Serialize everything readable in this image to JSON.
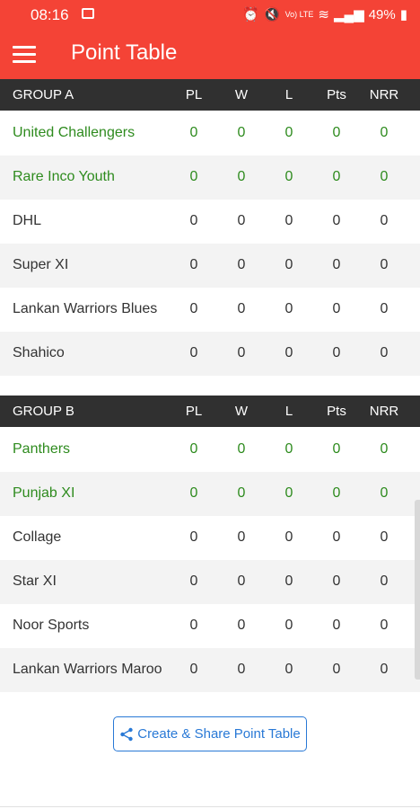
{
  "status": {
    "time": "08:16",
    "battery": "49%",
    "network": "Vo) LTE"
  },
  "app": {
    "title": "Point Table"
  },
  "columns": [
    "PL",
    "W",
    "L",
    "Pts",
    "NRR"
  ],
  "groups": [
    {
      "name": "GROUP A",
      "rows": [
        {
          "team": "United Challengers",
          "pl": "0",
          "w": "0",
          "l": "0",
          "pts": "0",
          "nrr": "0"
        },
        {
          "team": "Rare Inco Youth",
          "pl": "0",
          "w": "0",
          "l": "0",
          "pts": "0",
          "nrr": "0"
        },
        {
          "team": "DHL",
          "pl": "0",
          "w": "0",
          "l": "0",
          "pts": "0",
          "nrr": "0"
        },
        {
          "team": "Super XI",
          "pl": "0",
          "w": "0",
          "l": "0",
          "pts": "0",
          "nrr": "0"
        },
        {
          "team": "Lankan Warriors Blues",
          "pl": "0",
          "w": "0",
          "l": "0",
          "pts": "0",
          "nrr": "0"
        },
        {
          "team": "Shahico",
          "pl": "0",
          "w": "0",
          "l": "0",
          "pts": "0",
          "nrr": "0"
        }
      ]
    },
    {
      "name": "GROUP B",
      "rows": [
        {
          "team": "Panthers",
          "pl": "0",
          "w": "0",
          "l": "0",
          "pts": "0",
          "nrr": "0"
        },
        {
          "team": "Punjab XI",
          "pl": "0",
          "w": "0",
          "l": "0",
          "pts": "0",
          "nrr": "0"
        },
        {
          "team": "Collage",
          "pl": "0",
          "w": "0",
          "l": "0",
          "pts": "0",
          "nrr": "0"
        },
        {
          "team": "Star XI",
          "pl": "0",
          "w": "0",
          "l": "0",
          "pts": "0",
          "nrr": "0"
        },
        {
          "team": "Noor Sports",
          "pl": "0",
          "w": "0",
          "l": "0",
          "pts": "0",
          "nrr": "0"
        },
        {
          "team": "Lankan Warriors Maroo",
          "pl": "0",
          "w": "0",
          "l": "0",
          "pts": "0",
          "nrr": "0"
        }
      ]
    }
  ],
  "share_button": {
    "label": "Create & Share Point Table",
    "icon": "share-icon"
  },
  "colors": {
    "accent": "#f44336",
    "header_bg": "#303030",
    "qualified_text": "#2e8b1e",
    "button": "#2979d6"
  }
}
